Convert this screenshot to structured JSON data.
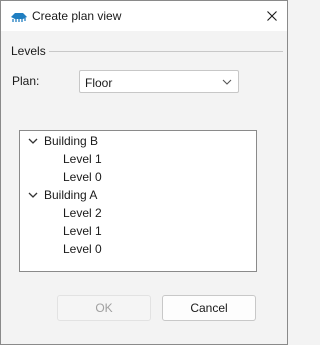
{
  "window": {
    "title": "Create plan view",
    "icon": "plan-view-app-icon",
    "close_icon": "close-icon"
  },
  "group": {
    "label": "Levels"
  },
  "plan": {
    "label": "Plan:",
    "value": "Floor",
    "arrow_icon": "chevron-down-icon"
  },
  "tree": {
    "buildings": [
      {
        "label": "Building B",
        "expanded": true,
        "levels": [
          "Level 1",
          "Level 0"
        ]
      },
      {
        "label": "Building A",
        "expanded": true,
        "levels": [
          "Level 2",
          "Level 1",
          "Level 0"
        ]
      }
    ]
  },
  "buttons": {
    "ok": {
      "label": "OK",
      "enabled": false
    },
    "cancel": {
      "label": "Cancel",
      "enabled": true
    }
  },
  "colors": {
    "icon_blue": "#1f7ec1",
    "disabled_text": "#a0a0a0"
  }
}
